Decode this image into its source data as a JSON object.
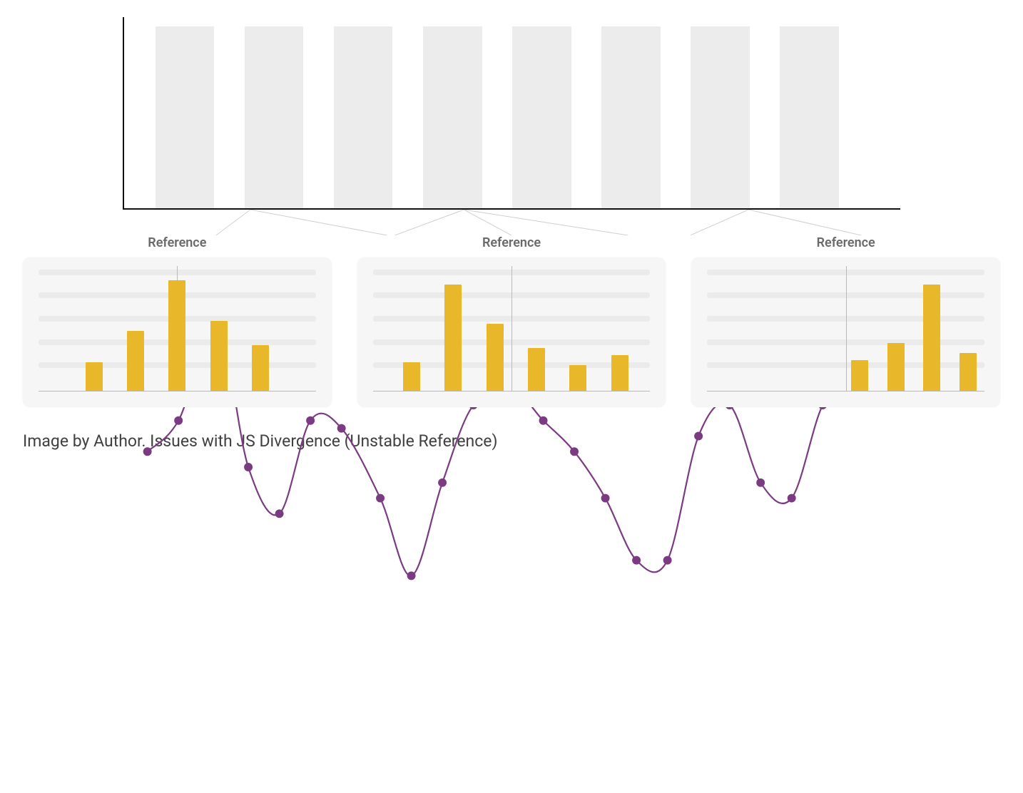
{
  "caption": "Image by Author. Issues with JS Divergence (Unstable Reference)",
  "reference_label": "Reference",
  "chart_data": {
    "top": {
      "type": "line",
      "title": "",
      "xlabel": "",
      "ylabel": "",
      "ylim": [
        0,
        100
      ],
      "background_bands": [
        {
          "x_pct": 4.0,
          "w_pct": 7.6,
          "h_pct": 95
        },
        {
          "x_pct": 15.5,
          "w_pct": 7.6,
          "h_pct": 95
        },
        {
          "x_pct": 27.0,
          "w_pct": 7.6,
          "h_pct": 95
        },
        {
          "x_pct": 38.5,
          "w_pct": 7.6,
          "h_pct": 95
        },
        {
          "x_pct": 50.0,
          "w_pct": 7.6,
          "h_pct": 95
        },
        {
          "x_pct": 61.5,
          "w_pct": 7.6,
          "h_pct": 95
        },
        {
          "x_pct": 73.0,
          "w_pct": 7.6,
          "h_pct": 95
        },
        {
          "x_pct": 84.5,
          "w_pct": 7.6,
          "h_pct": 95
        }
      ],
      "points": [
        {
          "x_pct": 3,
          "y_pct": 44
        },
        {
          "x_pct": 7,
          "y_pct": 48
        },
        {
          "x_pct": 12,
          "y_pct": 60
        },
        {
          "x_pct": 16,
          "y_pct": 42
        },
        {
          "x_pct": 20,
          "y_pct": 36
        },
        {
          "x_pct": 24,
          "y_pct": 48
        },
        {
          "x_pct": 28,
          "y_pct": 47
        },
        {
          "x_pct": 33,
          "y_pct": 38
        },
        {
          "x_pct": 37,
          "y_pct": 28
        },
        {
          "x_pct": 41,
          "y_pct": 40
        },
        {
          "x_pct": 45,
          "y_pct": 50
        },
        {
          "x_pct": 50,
          "y_pct": 52
        },
        {
          "x_pct": 54,
          "y_pct": 48
        },
        {
          "x_pct": 58,
          "y_pct": 44
        },
        {
          "x_pct": 62,
          "y_pct": 38
        },
        {
          "x_pct": 66,
          "y_pct": 30
        },
        {
          "x_pct": 70,
          "y_pct": 30
        },
        {
          "x_pct": 74,
          "y_pct": 46
        },
        {
          "x_pct": 78,
          "y_pct": 50
        },
        {
          "x_pct": 82,
          "y_pct": 40
        },
        {
          "x_pct": 86,
          "y_pct": 38
        },
        {
          "x_pct": 90,
          "y_pct": 50
        },
        {
          "x_pct": 94,
          "y_pct": 54
        },
        {
          "x_pct": 98,
          "y_pct": 54
        }
      ]
    },
    "small": [
      {
        "type": "bar",
        "title": "Reference",
        "ylim": [
          0,
          100
        ],
        "grid_rows": 5,
        "axis_x_pct": 50,
        "bars": [
          {
            "x_pct": 20,
            "h_pct": 24
          },
          {
            "x_pct": 35,
            "h_pct": 50
          },
          {
            "x_pct": 50,
            "h_pct": 92
          },
          {
            "x_pct": 65,
            "h_pct": 58
          },
          {
            "x_pct": 80,
            "h_pct": 38
          }
        ]
      },
      {
        "type": "bar",
        "title": "Reference",
        "ylim": [
          0,
          100
        ],
        "grid_rows": 5,
        "axis_x_pct": 50,
        "bars": [
          {
            "x_pct": 14,
            "h_pct": 24
          },
          {
            "x_pct": 29,
            "h_pct": 88
          },
          {
            "x_pct": 44,
            "h_pct": 56
          },
          {
            "x_pct": 59,
            "h_pct": 36
          },
          {
            "x_pct": 74,
            "h_pct": 22
          },
          {
            "x_pct": 89,
            "h_pct": 30
          }
        ]
      },
      {
        "type": "bar",
        "title": "Reference",
        "ylim": [
          0,
          100
        ],
        "grid_rows": 5,
        "axis_x_pct": 50,
        "bars": [
          {
            "x_pct": 55,
            "h_pct": 26
          },
          {
            "x_pct": 68,
            "h_pct": 40
          },
          {
            "x_pct": 81,
            "h_pct": 88
          },
          {
            "x_pct": 94,
            "h_pct": 32
          }
        ]
      }
    ]
  }
}
